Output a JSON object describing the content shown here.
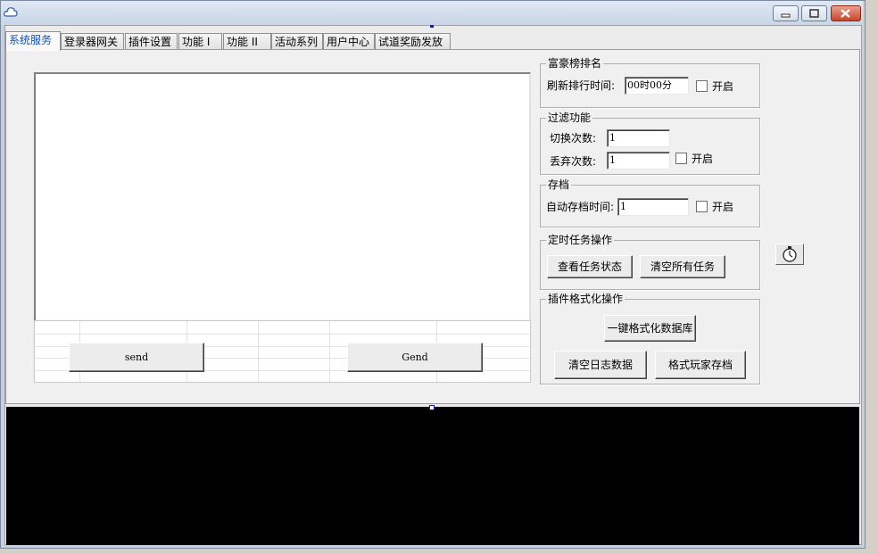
{
  "tabs": [
    {
      "label": "系统服务",
      "active": true
    },
    {
      "label": "登录器网关",
      "active": false
    },
    {
      "label": "插件设置",
      "active": false
    },
    {
      "label": "功能 I",
      "active": false
    },
    {
      "label": "功能 II",
      "active": false
    },
    {
      "label": "活动系列",
      "active": false
    },
    {
      "label": "用户中心",
      "active": false
    },
    {
      "label": "试道奖励发放",
      "active": false
    }
  ],
  "left_panel": {
    "send_label": "send",
    "gend_label": "Gend"
  },
  "rich_rank": {
    "title": "富豪榜排名",
    "refresh_label": "刷新排行时间:",
    "refresh_value": "00时00分",
    "enable_label": "开启"
  },
  "filter": {
    "title": "过滤功能",
    "switch_label": "切换次数:",
    "switch_value": "1",
    "discard_label": "丢弃次数:",
    "discard_value": "1",
    "enable_label": "开启"
  },
  "archive": {
    "title": "存档",
    "auto_label": "自动存档时间:",
    "auto_value": "1",
    "enable_label": "开启"
  },
  "scheduled": {
    "title": "定时任务操作",
    "view_label": "查看任务状态",
    "clear_label": "清空所有任务"
  },
  "plugin_format": {
    "title": "插件格式化操作",
    "format_db_label": "一键格式化数据库",
    "clear_log_label": "清空日志数据",
    "format_player_label": "格式玩家存档"
  },
  "icons": {
    "app": "cloud-icon",
    "timer": "stopwatch-icon"
  }
}
